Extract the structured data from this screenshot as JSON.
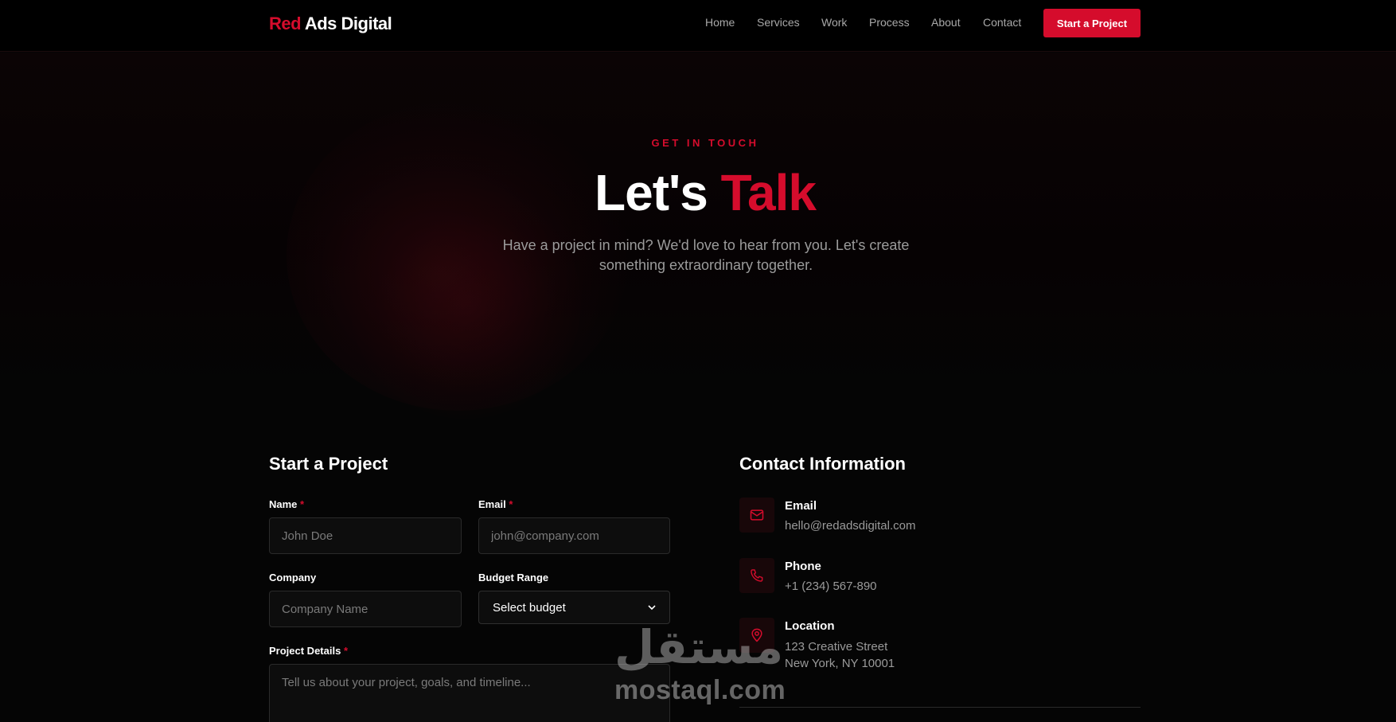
{
  "nav": {
    "brand_red": "Red",
    "brand_white": " Ads Digital",
    "links": [
      "Home",
      "Services",
      "Work",
      "Process",
      "About",
      "Contact"
    ],
    "cta_label": "Start a Project"
  },
  "hero": {
    "eyebrow": "GET IN TOUCH",
    "title_white": "Let's ",
    "title_red": "Talk",
    "subtitle": "Have a project in mind? We'd love to hear from you. Let's create something extraordinary together."
  },
  "form": {
    "title": "Start a Project",
    "name_label": "Name",
    "name_placeholder": "John Doe",
    "email_label": "Email",
    "email_placeholder": "john@company.com",
    "company_label": "Company",
    "company_placeholder": "Company Name",
    "budget_label": "Budget Range",
    "budget_selected": "Select budget",
    "details_label": "Project Details",
    "details_placeholder": "Tell us about your project, goals, and timeline...",
    "required_mark": "*"
  },
  "contact": {
    "title": "Contact Information",
    "email_title": "Email",
    "email_value": "hello@redadsdigital.com",
    "phone_title": "Phone",
    "phone_value": "+1 (234) 567-890",
    "location_title": "Location",
    "location_line1": "123 Creative Street",
    "location_line2": "New York, NY 10001"
  },
  "watermark": {
    "arabic": "مستقل",
    "latin": "mostaql.com"
  },
  "colors": {
    "accent": "#d50c2c",
    "background": "#050505",
    "muted_text": "#9a9a9a"
  },
  "icons": [
    "mail-icon",
    "phone-icon",
    "map-pin-icon",
    "chevron-down-icon"
  ]
}
